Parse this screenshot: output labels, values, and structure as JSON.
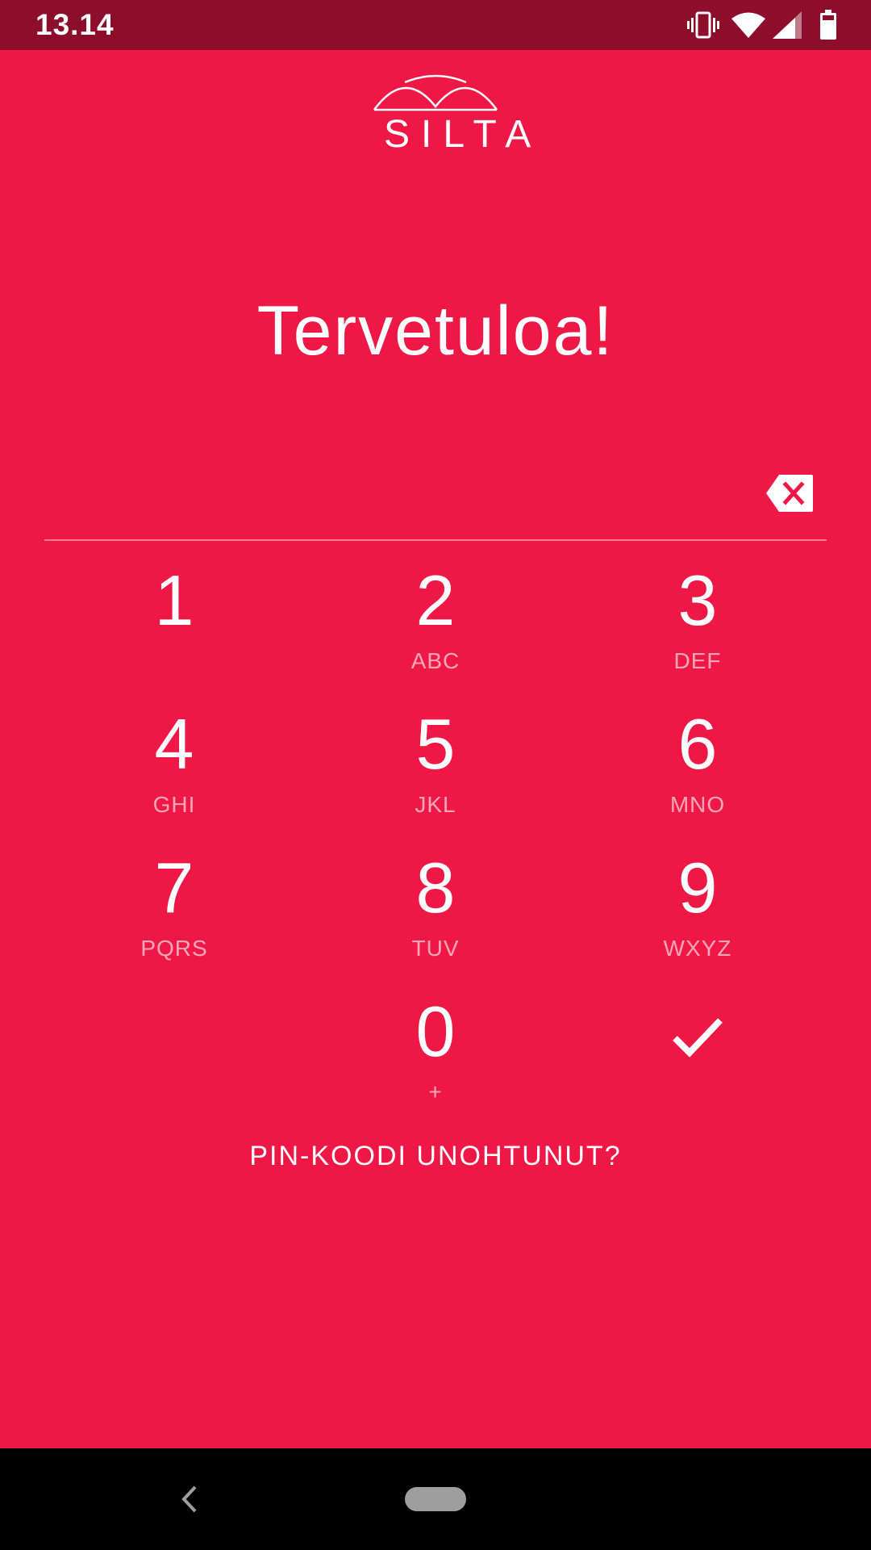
{
  "status_bar": {
    "time": "13.14",
    "icons": [
      "vibrate-icon",
      "wifi-icon",
      "signal-icon",
      "battery-icon"
    ]
  },
  "logo": {
    "text": "SILTA"
  },
  "welcome": {
    "title": "Tervetuloa!"
  },
  "keypad": {
    "keys": [
      {
        "digit": "1",
        "letters": ""
      },
      {
        "digit": "2",
        "letters": "ABC"
      },
      {
        "digit": "3",
        "letters": "DEF"
      },
      {
        "digit": "4",
        "letters": "GHI"
      },
      {
        "digit": "5",
        "letters": "JKL"
      },
      {
        "digit": "6",
        "letters": "MNO"
      },
      {
        "digit": "7",
        "letters": "PQRS"
      },
      {
        "digit": "8",
        "letters": "TUV"
      },
      {
        "digit": "9",
        "letters": "WXYZ"
      },
      {
        "digit": "0",
        "letters": "+"
      }
    ]
  },
  "actions": {
    "forgot_pin": "PIN-KOODI UNOHTUNUT?"
  },
  "colors": {
    "background": "#ef1745",
    "status_bar": "#8d0e2b",
    "nav_bar": "#000000"
  }
}
